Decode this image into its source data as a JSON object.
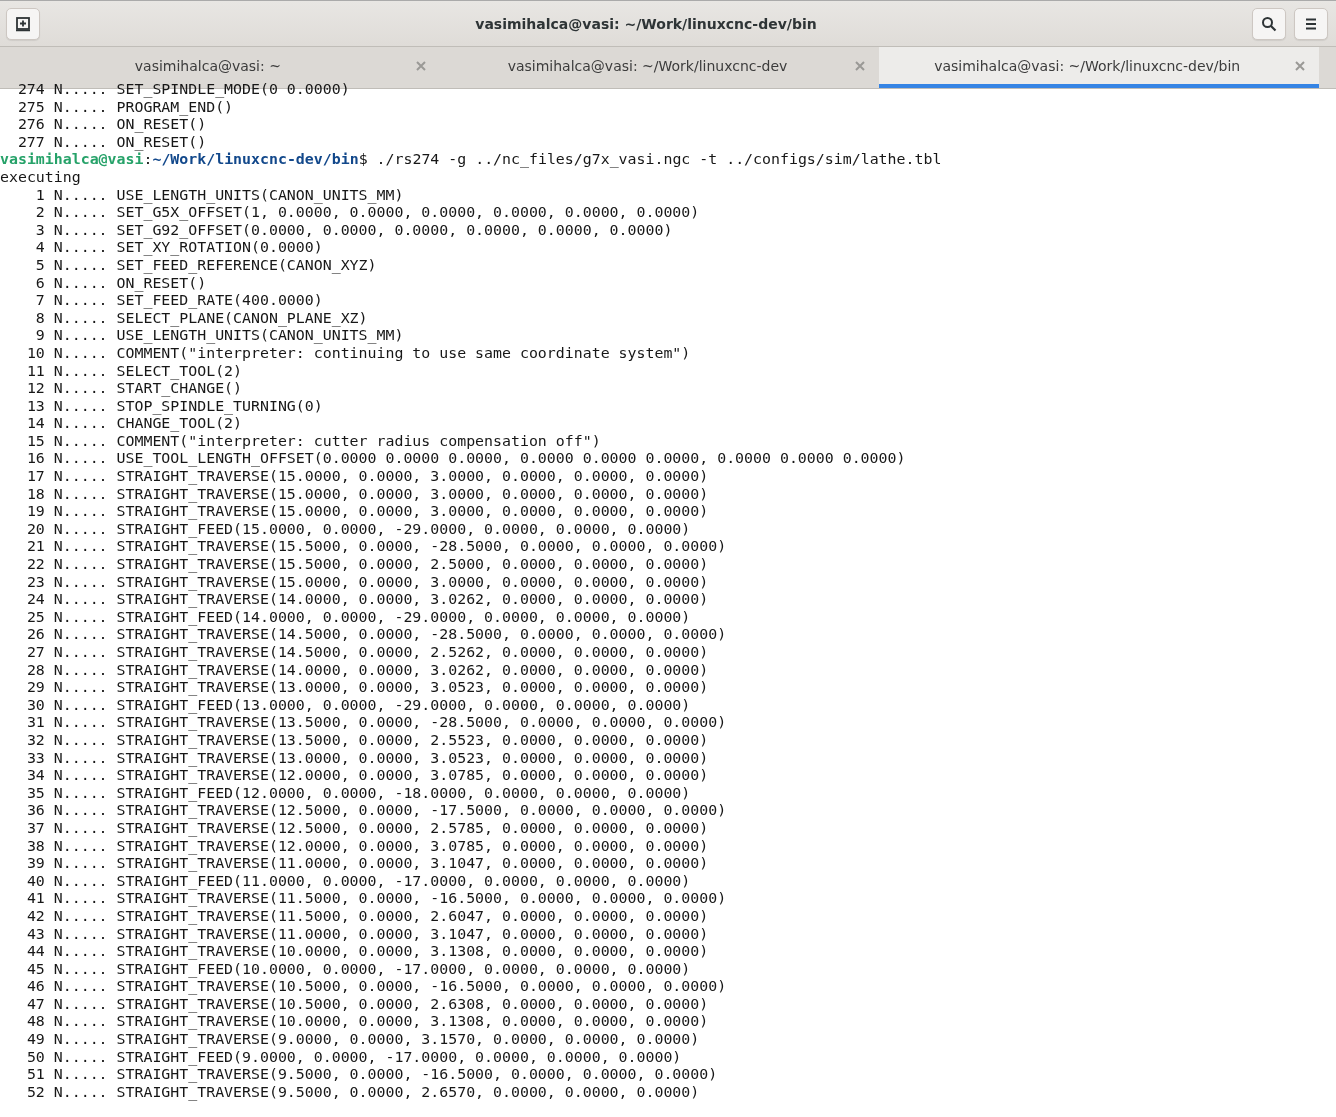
{
  "window": {
    "title": "vasimihalca@vasi: ~/Work/linuxcnc-dev/bin"
  },
  "tabs": [
    {
      "label": "vasimihalca@vasi: ~",
      "selected": false
    },
    {
      "label": "vasimihalca@vasi: ~/Work/linuxcnc-dev",
      "selected": false
    },
    {
      "label": "vasimihalca@vasi: ~/Work/linuxcnc-dev/bin",
      "selected": true
    }
  ],
  "terminal": {
    "lines": [
      {
        "kind": "numbered",
        "number": "274",
        "text": "N..... SET_SPINDLE_MODE(0 0.0000)"
      },
      {
        "kind": "numbered",
        "number": "275",
        "text": "N..... PROGRAM_END()"
      },
      {
        "kind": "numbered",
        "number": "276",
        "text": "N..... ON_RESET()"
      },
      {
        "kind": "numbered",
        "number": "277",
        "text": "N..... ON_RESET()"
      },
      {
        "kind": "prompt",
        "user": "vasimihalca@vasi",
        "separator": ":",
        "path": "~/Work/linuxcnc-dev/bin",
        "command": "$ ./rs274 -g ../nc_files/g7x_vasi.ngc -t ../configs/sim/lathe.tbl"
      },
      {
        "kind": "plain",
        "text": "executing"
      },
      {
        "kind": "numbered",
        "number": "1",
        "text": "N..... USE_LENGTH_UNITS(CANON_UNITS_MM)"
      },
      {
        "kind": "numbered",
        "number": "2",
        "text": "N..... SET_G5X_OFFSET(1, 0.0000, 0.0000, 0.0000, 0.0000, 0.0000, 0.0000)"
      },
      {
        "kind": "numbered",
        "number": "3",
        "text": "N..... SET_G92_OFFSET(0.0000, 0.0000, 0.0000, 0.0000, 0.0000, 0.0000)"
      },
      {
        "kind": "numbered",
        "number": "4",
        "text": "N..... SET_XY_ROTATION(0.0000)"
      },
      {
        "kind": "numbered",
        "number": "5",
        "text": "N..... SET_FEED_REFERENCE(CANON_XYZ)"
      },
      {
        "kind": "numbered",
        "number": "6",
        "text": "N..... ON_RESET()"
      },
      {
        "kind": "numbered",
        "number": "7",
        "text": "N..... SET_FEED_RATE(400.0000)"
      },
      {
        "kind": "numbered",
        "number": "8",
        "text": "N..... SELECT_PLANE(CANON_PLANE_XZ)"
      },
      {
        "kind": "numbered",
        "number": "9",
        "text": "N..... USE_LENGTH_UNITS(CANON_UNITS_MM)"
      },
      {
        "kind": "numbered",
        "number": "10",
        "text": "N..... COMMENT(\"interpreter: continuing to use same coordinate system\")"
      },
      {
        "kind": "numbered",
        "number": "11",
        "text": "N..... SELECT_TOOL(2)"
      },
      {
        "kind": "numbered",
        "number": "12",
        "text": "N..... START_CHANGE()"
      },
      {
        "kind": "numbered",
        "number": "13",
        "text": "N..... STOP_SPINDLE_TURNING(0)"
      },
      {
        "kind": "numbered",
        "number": "14",
        "text": "N..... CHANGE_TOOL(2)"
      },
      {
        "kind": "numbered",
        "number": "15",
        "text": "N..... COMMENT(\"interpreter: cutter radius compensation off\")"
      },
      {
        "kind": "numbered",
        "number": "16",
        "text": "N..... USE_TOOL_LENGTH_OFFSET(0.0000 0.0000 0.0000, 0.0000 0.0000 0.0000, 0.0000 0.0000 0.0000)"
      },
      {
        "kind": "numbered",
        "number": "17",
        "text": "N..... STRAIGHT_TRAVERSE(15.0000, 0.0000, 3.0000, 0.0000, 0.0000, 0.0000)"
      },
      {
        "kind": "numbered",
        "number": "18",
        "text": "N..... STRAIGHT_TRAVERSE(15.0000, 0.0000, 3.0000, 0.0000, 0.0000, 0.0000)"
      },
      {
        "kind": "numbered",
        "number": "19",
        "text": "N..... STRAIGHT_TRAVERSE(15.0000, 0.0000, 3.0000, 0.0000, 0.0000, 0.0000)"
      },
      {
        "kind": "numbered",
        "number": "20",
        "text": "N..... STRAIGHT_FEED(15.0000, 0.0000, -29.0000, 0.0000, 0.0000, 0.0000)"
      },
      {
        "kind": "numbered",
        "number": "21",
        "text": "N..... STRAIGHT_TRAVERSE(15.5000, 0.0000, -28.5000, 0.0000, 0.0000, 0.0000)"
      },
      {
        "kind": "numbered",
        "number": "22",
        "text": "N..... STRAIGHT_TRAVERSE(15.5000, 0.0000, 2.5000, 0.0000, 0.0000, 0.0000)"
      },
      {
        "kind": "numbered",
        "number": "23",
        "text": "N..... STRAIGHT_TRAVERSE(15.0000, 0.0000, 3.0000, 0.0000, 0.0000, 0.0000)"
      },
      {
        "kind": "numbered",
        "number": "24",
        "text": "N..... STRAIGHT_TRAVERSE(14.0000, 0.0000, 3.0262, 0.0000, 0.0000, 0.0000)"
      },
      {
        "kind": "numbered",
        "number": "25",
        "text": "N..... STRAIGHT_FEED(14.0000, 0.0000, -29.0000, 0.0000, 0.0000, 0.0000)"
      },
      {
        "kind": "numbered",
        "number": "26",
        "text": "N..... STRAIGHT_TRAVERSE(14.5000, 0.0000, -28.5000, 0.0000, 0.0000, 0.0000)"
      },
      {
        "kind": "numbered",
        "number": "27",
        "text": "N..... STRAIGHT_TRAVERSE(14.5000, 0.0000, 2.5262, 0.0000, 0.0000, 0.0000)"
      },
      {
        "kind": "numbered",
        "number": "28",
        "text": "N..... STRAIGHT_TRAVERSE(14.0000, 0.0000, 3.0262, 0.0000, 0.0000, 0.0000)"
      },
      {
        "kind": "numbered",
        "number": "29",
        "text": "N..... STRAIGHT_TRAVERSE(13.0000, 0.0000, 3.0523, 0.0000, 0.0000, 0.0000)"
      },
      {
        "kind": "numbered",
        "number": "30",
        "text": "N..... STRAIGHT_FEED(13.0000, 0.0000, -29.0000, 0.0000, 0.0000, 0.0000)"
      },
      {
        "kind": "numbered",
        "number": "31",
        "text": "N..... STRAIGHT_TRAVERSE(13.5000, 0.0000, -28.5000, 0.0000, 0.0000, 0.0000)"
      },
      {
        "kind": "numbered",
        "number": "32",
        "text": "N..... STRAIGHT_TRAVERSE(13.5000, 0.0000, 2.5523, 0.0000, 0.0000, 0.0000)"
      },
      {
        "kind": "numbered",
        "number": "33",
        "text": "N..... STRAIGHT_TRAVERSE(13.0000, 0.0000, 3.0523, 0.0000, 0.0000, 0.0000)"
      },
      {
        "kind": "numbered",
        "number": "34",
        "text": "N..... STRAIGHT_TRAVERSE(12.0000, 0.0000, 3.0785, 0.0000, 0.0000, 0.0000)"
      },
      {
        "kind": "numbered",
        "number": "35",
        "text": "N..... STRAIGHT_FEED(12.0000, 0.0000, -18.0000, 0.0000, 0.0000, 0.0000)"
      },
      {
        "kind": "numbered",
        "number": "36",
        "text": "N..... STRAIGHT_TRAVERSE(12.5000, 0.0000, -17.5000, 0.0000, 0.0000, 0.0000)"
      },
      {
        "kind": "numbered",
        "number": "37",
        "text": "N..... STRAIGHT_TRAVERSE(12.5000, 0.0000, 2.5785, 0.0000, 0.0000, 0.0000)"
      },
      {
        "kind": "numbered",
        "number": "38",
        "text": "N..... STRAIGHT_TRAVERSE(12.0000, 0.0000, 3.0785, 0.0000, 0.0000, 0.0000)"
      },
      {
        "kind": "numbered",
        "number": "39",
        "text": "N..... STRAIGHT_TRAVERSE(11.0000, 0.0000, 3.1047, 0.0000, 0.0000, 0.0000)"
      },
      {
        "kind": "numbered",
        "number": "40",
        "text": "N..... STRAIGHT_FEED(11.0000, 0.0000, -17.0000, 0.0000, 0.0000, 0.0000)"
      },
      {
        "kind": "numbered",
        "number": "41",
        "text": "N..... STRAIGHT_TRAVERSE(11.5000, 0.0000, -16.5000, 0.0000, 0.0000, 0.0000)"
      },
      {
        "kind": "numbered",
        "number": "42",
        "text": "N..... STRAIGHT_TRAVERSE(11.5000, 0.0000, 2.6047, 0.0000, 0.0000, 0.0000)"
      },
      {
        "kind": "numbered",
        "number": "43",
        "text": "N..... STRAIGHT_TRAVERSE(11.0000, 0.0000, 3.1047, 0.0000, 0.0000, 0.0000)"
      },
      {
        "kind": "numbered",
        "number": "44",
        "text": "N..... STRAIGHT_TRAVERSE(10.0000, 0.0000, 3.1308, 0.0000, 0.0000, 0.0000)"
      },
      {
        "kind": "numbered",
        "number": "45",
        "text": "N..... STRAIGHT_FEED(10.0000, 0.0000, -17.0000, 0.0000, 0.0000, 0.0000)"
      },
      {
        "kind": "numbered",
        "number": "46",
        "text": "N..... STRAIGHT_TRAVERSE(10.5000, 0.0000, -16.5000, 0.0000, 0.0000, 0.0000)"
      },
      {
        "kind": "numbered",
        "number": "47",
        "text": "N..... STRAIGHT_TRAVERSE(10.5000, 0.0000, 2.6308, 0.0000, 0.0000, 0.0000)"
      },
      {
        "kind": "numbered",
        "number": "48",
        "text": "N..... STRAIGHT_TRAVERSE(10.0000, 0.0000, 3.1308, 0.0000, 0.0000, 0.0000)"
      },
      {
        "kind": "numbered",
        "number": "49",
        "text": "N..... STRAIGHT_TRAVERSE(9.0000, 0.0000, 3.1570, 0.0000, 0.0000, 0.0000)"
      },
      {
        "kind": "numbered",
        "number": "50",
        "text": "N..... STRAIGHT_FEED(9.0000, 0.0000, -17.0000, 0.0000, 0.0000, 0.0000)"
      },
      {
        "kind": "numbered",
        "number": "51",
        "text": "N..... STRAIGHT_TRAVERSE(9.5000, 0.0000, -16.5000, 0.0000, 0.0000, 0.0000)"
      },
      {
        "kind": "numbered",
        "number": "52",
        "text": "N..... STRAIGHT_TRAVERSE(9.5000, 0.0000, 2.6570, 0.0000, 0.0000, 0.0000)"
      }
    ]
  }
}
